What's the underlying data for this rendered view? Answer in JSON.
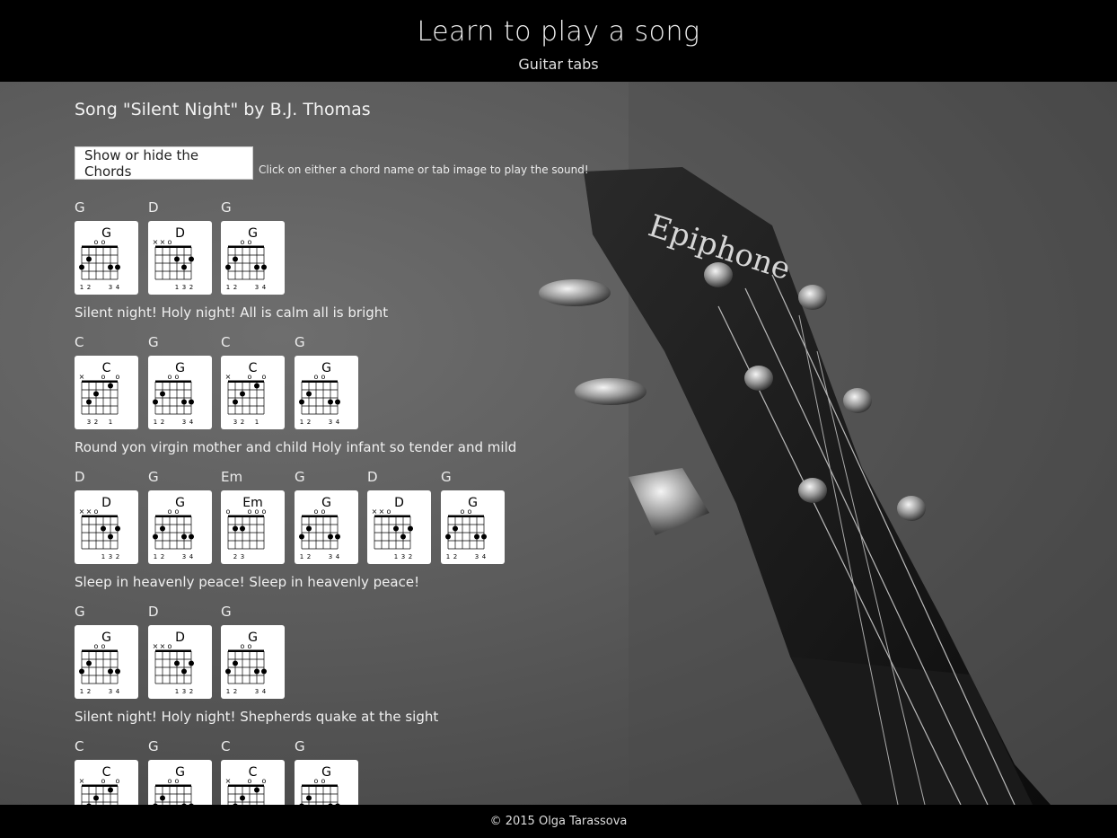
{
  "header": {
    "title": "Learn to play a song",
    "subtitle": "Guitar tabs"
  },
  "song": {
    "title": "Song \"Silent Night\" by B.J. Thomas",
    "toggle_label": "Show or hide the Chords",
    "hint": "Click on either a chord name or tab image to play the sound!"
  },
  "lines": [
    {
      "chords": [
        "G",
        "D",
        "G"
      ],
      "lyric": "Silent night! Holy night! All is calm all is bright"
    },
    {
      "chords": [
        "C",
        "G",
        "C",
        "G"
      ],
      "lyric": "Round yon virgin mother and child Holy infant so tender and mild"
    },
    {
      "chords": [
        "D",
        "G",
        "Em",
        "G",
        "D",
        "G"
      ],
      "lyric": "Sleep in heavenly peace! Sleep in heavenly peace!"
    },
    {
      "chords": [
        "G",
        "D",
        "G"
      ],
      "lyric": "Silent night! Holy night! Shepherds quake at the sight"
    },
    {
      "chords": [
        "C",
        "G",
        "C",
        "G"
      ],
      "lyric": ""
    }
  ],
  "chord_shapes": {
    "G": {
      "markers": [
        "",
        "",
        "o",
        "o",
        "",
        ""
      ],
      "fingers": "12  34"
    },
    "D": {
      "markers": [
        "x",
        "x",
        "o",
        "",
        "",
        ""
      ],
      "fingers": "   132"
    },
    "C": {
      "markers": [
        "x",
        "",
        "",
        "o",
        "",
        "o"
      ],
      "fingers": " 32 1 "
    },
    "Em": {
      "markers": [
        "o",
        "",
        "",
        "o",
        "o",
        "o"
      ],
      "fingers": " 23   "
    }
  },
  "brand_text": "Epiphone",
  "footer": {
    "copyright": "© 2015 Olga Tarassova"
  }
}
